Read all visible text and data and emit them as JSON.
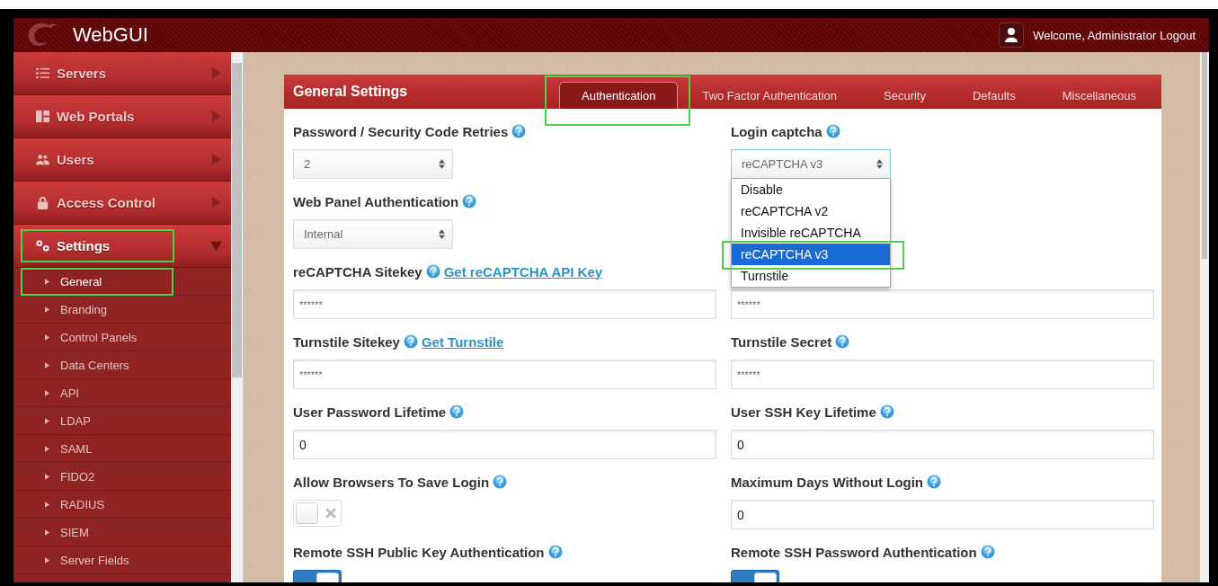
{
  "header": {
    "title": "WebGUI",
    "welcome": "Welcome, Administrator",
    "logout": "Logout"
  },
  "sidebar": {
    "items": [
      {
        "label": "Servers",
        "expanded": false,
        "highlighted": false
      },
      {
        "label": "Web Portals",
        "expanded": false,
        "highlighted": false
      },
      {
        "label": "Users",
        "expanded": false,
        "highlighted": false
      },
      {
        "label": "Access Control",
        "expanded": false,
        "highlighted": false
      },
      {
        "label": "Settings",
        "expanded": true,
        "highlighted": true,
        "children": [
          {
            "label": "General",
            "selected": true,
            "highlighted": true
          },
          {
            "label": "Branding",
            "selected": false,
            "highlighted": false
          },
          {
            "label": "Control Panels",
            "selected": false,
            "highlighted": false
          },
          {
            "label": "Data Centers",
            "selected": false,
            "highlighted": false
          },
          {
            "label": "API",
            "selected": false,
            "highlighted": false
          },
          {
            "label": "LDAP",
            "selected": false,
            "highlighted": false
          },
          {
            "label": "SAML",
            "selected": false,
            "highlighted": false
          },
          {
            "label": "FIDO2",
            "selected": false,
            "highlighted": false
          },
          {
            "label": "RADIUS",
            "selected": false,
            "highlighted": false
          },
          {
            "label": "SIEM",
            "selected": false,
            "highlighted": false
          },
          {
            "label": "Server Fields",
            "selected": false,
            "highlighted": false
          }
        ]
      }
    ]
  },
  "panel": {
    "title": "General Settings",
    "tabs": [
      {
        "label": "Authentication",
        "selected": true,
        "highlighted": true
      },
      {
        "label": "Two Factor Authentication",
        "selected": false,
        "highlighted": false
      },
      {
        "label": "Security",
        "selected": false,
        "highlighted": false
      },
      {
        "label": "Defaults",
        "selected": false,
        "highlighted": false
      },
      {
        "label": "Miscellaneous",
        "selected": false,
        "highlighted": false
      }
    ],
    "rows": [
      {
        "left": {
          "label": "Password / Security Code Retries",
          "kind": "select",
          "value": "2"
        },
        "right": {
          "label": "Login captcha",
          "kind": "select",
          "value": "reCAPTCHA v3",
          "open": true,
          "options": [
            {
              "label": "Disable",
              "selected": false,
              "highlighted": false
            },
            {
              "label": "reCAPTCHA v2",
              "selected": false,
              "highlighted": false
            },
            {
              "label": "Invisible reCAPTCHA",
              "selected": false,
              "highlighted": false
            },
            {
              "label": "reCAPTCHA v3",
              "selected": true,
              "highlighted": true
            },
            {
              "label": "Turnstile",
              "selected": false,
              "highlighted": false
            }
          ]
        }
      },
      {
        "left": {
          "label": "Web Panel Authentication",
          "kind": "select",
          "value": "Internal"
        },
        "right": null
      },
      {
        "left": {
          "label": "reCAPTCHA Sitekey",
          "link": "Get reCAPTCHA API Key",
          "kind": "text",
          "value": "******"
        },
        "right": {
          "kind": "text",
          "value": "******"
        }
      },
      {
        "left": {
          "label": "Turnstile Sitekey",
          "link": "Get Turnstile",
          "kind": "text",
          "value": "******"
        },
        "right": {
          "label": "Turnstile Secret",
          "kind": "text",
          "value": "******"
        }
      },
      {
        "left": {
          "label": "User Password Lifetime",
          "kind": "text",
          "value": "0"
        },
        "right": {
          "label": "User SSH Key Lifetime",
          "kind": "text",
          "value": "0"
        }
      },
      {
        "left": {
          "label": "Allow Browsers To Save Login",
          "kind": "toggle",
          "on": false
        },
        "right": {
          "label": "Maximum Days Without Login",
          "kind": "text",
          "value": "0"
        }
      },
      {
        "left": {
          "label": "Remote SSH Public Key Authentication",
          "kind": "toggle",
          "on": true
        },
        "right": {
          "label": "Remote SSH Password Authentication",
          "kind": "toggle",
          "on": true
        }
      }
    ]
  }
}
